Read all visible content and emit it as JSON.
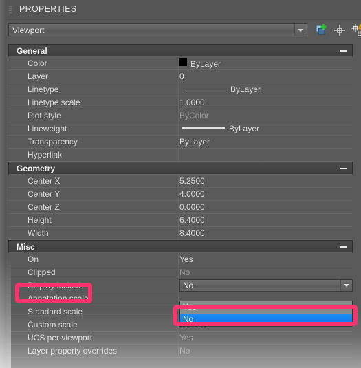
{
  "window": {
    "title": "PROPERTIES",
    "grip_icon": "drag-grip-icon"
  },
  "toolbar": {
    "object_type": "Viewport",
    "object_type_arrow": "chevron-down-icon",
    "buttons": [
      {
        "name": "quick-select-button",
        "icon": "stacked-squares-plus-icon",
        "label": ""
      },
      {
        "name": "select-objects-button",
        "icon": "crosshair-pick-icon",
        "label": ""
      },
      {
        "name": "quick-select-filter-button",
        "icon": "crosshair-lightning-table-icon",
        "label": ""
      }
    ]
  },
  "sections": [
    {
      "name": "General",
      "collapse_icon": "minus-icon",
      "rows": [
        {
          "label": "Color",
          "value": "ByLayer",
          "kind": "color",
          "swatch": "#000000",
          "dim": false
        },
        {
          "label": "Layer",
          "value": "0",
          "kind": "text",
          "dim": false
        },
        {
          "label": "Linetype",
          "value": "ByLayer",
          "kind": "linetype",
          "dim": false
        },
        {
          "label": "Linetype scale",
          "value": "1.0000",
          "kind": "text",
          "dim": false
        },
        {
          "label": "Plot style",
          "value": "ByColor",
          "kind": "text",
          "dim": true
        },
        {
          "label": "Lineweight",
          "value": "ByLayer",
          "kind": "lineweight",
          "dim": false
        },
        {
          "label": "Transparency",
          "value": "ByLayer",
          "kind": "text",
          "dim": false
        },
        {
          "label": "Hyperlink",
          "value": "",
          "kind": "text",
          "dim": false
        }
      ]
    },
    {
      "name": "Geometry",
      "collapse_icon": "minus-icon",
      "rows": [
        {
          "label": "Center X",
          "value": "5.2500",
          "kind": "text",
          "dim": false
        },
        {
          "label": "Center Y",
          "value": "4.0000",
          "kind": "text",
          "dim": false
        },
        {
          "label": "Center Z",
          "value": "0.0000",
          "kind": "text",
          "dim": false
        },
        {
          "label": "Height",
          "value": "6.4000",
          "kind": "text",
          "dim": false
        },
        {
          "label": "Width",
          "value": "8.4000",
          "kind": "text",
          "dim": false
        }
      ]
    },
    {
      "name": "Misc",
      "collapse_icon": "minus-icon",
      "rows": [
        {
          "label": "On",
          "value": "Yes",
          "kind": "text",
          "dim": false
        },
        {
          "label": "Clipped",
          "value": "No",
          "kind": "text",
          "dim": true
        },
        {
          "label": "Display locked",
          "value": "No",
          "kind": "editor",
          "dim": false
        },
        {
          "label": "Annotation scale",
          "value": "",
          "kind": "text",
          "dim": false
        },
        {
          "label": "Standard scale",
          "value": "",
          "kind": "text",
          "dim": false
        },
        {
          "label": "Custom scale",
          "value": "0.0001",
          "kind": "text",
          "dim": false
        },
        {
          "label": "UCS per viewport",
          "value": "Yes",
          "kind": "text",
          "dim": true
        },
        {
          "label": "Layer property overrides",
          "value": "No",
          "kind": "text",
          "dim": true
        }
      ]
    }
  ],
  "dropdown": {
    "open": true,
    "options": [
      "Yes",
      "No"
    ],
    "selected": "No"
  },
  "annotations": {
    "color": "#f8336d",
    "highlighted_label": "Display locked",
    "highlighted_option": "No"
  }
}
